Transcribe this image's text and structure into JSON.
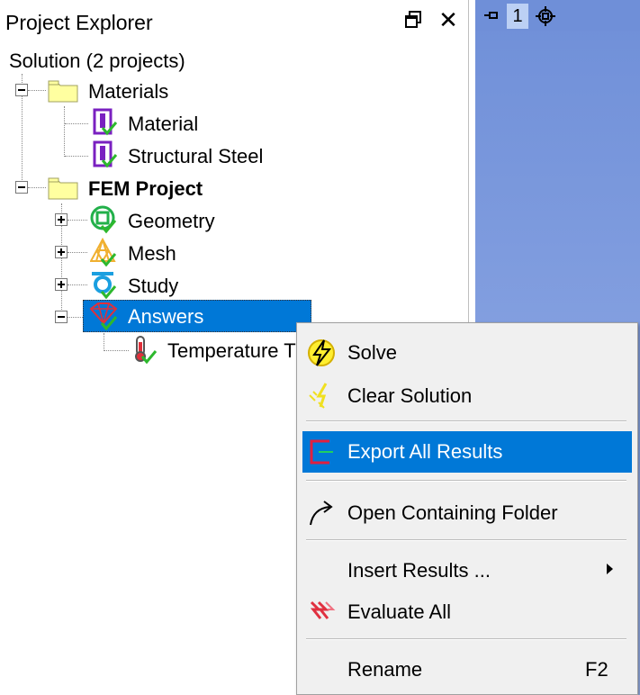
{
  "explorer": {
    "title": "Project Explorer",
    "close_glyph": "✕"
  },
  "tree": {
    "solution_label": "Solution (2 projects)",
    "materials": {
      "label": "Materials",
      "children": [
        "Material",
        "Structural Steel"
      ]
    },
    "project": {
      "label": "FEM Project",
      "children": {
        "geometry": "Geometry",
        "mesh": "Mesh",
        "study": "Study",
        "answers": "Answers",
        "temperature": "Temperature T"
      }
    }
  },
  "viewport": {
    "tab_number": "1"
  },
  "context_menu": {
    "items": [
      {
        "label": "Solve",
        "icon": "solve-icon"
      },
      {
        "label": "Clear Solution",
        "icon": "clear-solution-icon"
      },
      {
        "label": "Export All Results",
        "icon": "export-icon",
        "highlighted": true
      },
      {
        "label": "Open Containing Folder",
        "icon": "open-folder-arrow-icon"
      },
      {
        "label": "Insert Results ...",
        "submenu": true
      },
      {
        "label": "Evaluate All",
        "icon": "evaluate-all-icon"
      },
      {
        "label": "Rename",
        "shortcut": "F2"
      }
    ]
  },
  "colors": {
    "selection": "#0078d7",
    "viewport_top": "#6f8fd8",
    "viewport_bottom": "#98b0e8",
    "menu_bg": "#f0f0f0"
  }
}
